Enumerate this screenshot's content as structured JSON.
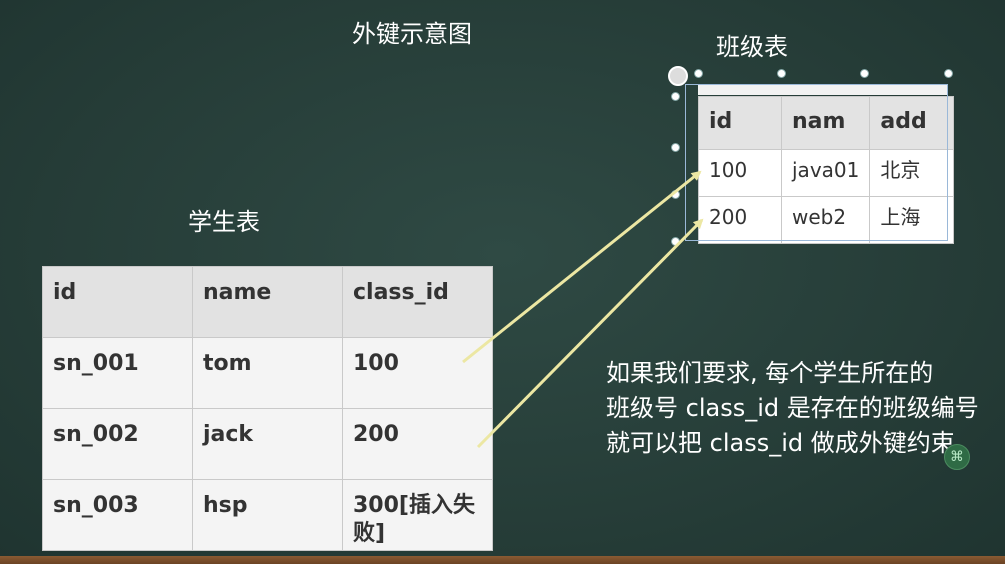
{
  "titles": {
    "main": "外键示意图",
    "class_table": "班级表",
    "student_table": "学生表"
  },
  "student_table": {
    "headers": [
      "id",
      "name",
      "class_id"
    ],
    "rows": [
      [
        "sn_001",
        "tom",
        "100"
      ],
      [
        "sn_002",
        "jack",
        "200"
      ],
      [
        "sn_003",
        "hsp",
        "300[插入失败]"
      ]
    ]
  },
  "class_table": {
    "headers": [
      "id",
      "nam",
      "add"
    ],
    "rows": [
      [
        "100",
        "java01",
        "北京"
      ],
      [
        "200",
        "web2",
        "上海"
      ]
    ]
  },
  "note": {
    "line1": "如果我们要求, 每个学生所在的",
    "line2": "班级号 class_id 是存在的班级编号",
    "line3": "就可以把 class_id 做成外键约束"
  },
  "colors": {
    "board": "#263d38",
    "arrow": "#ece7a3"
  }
}
